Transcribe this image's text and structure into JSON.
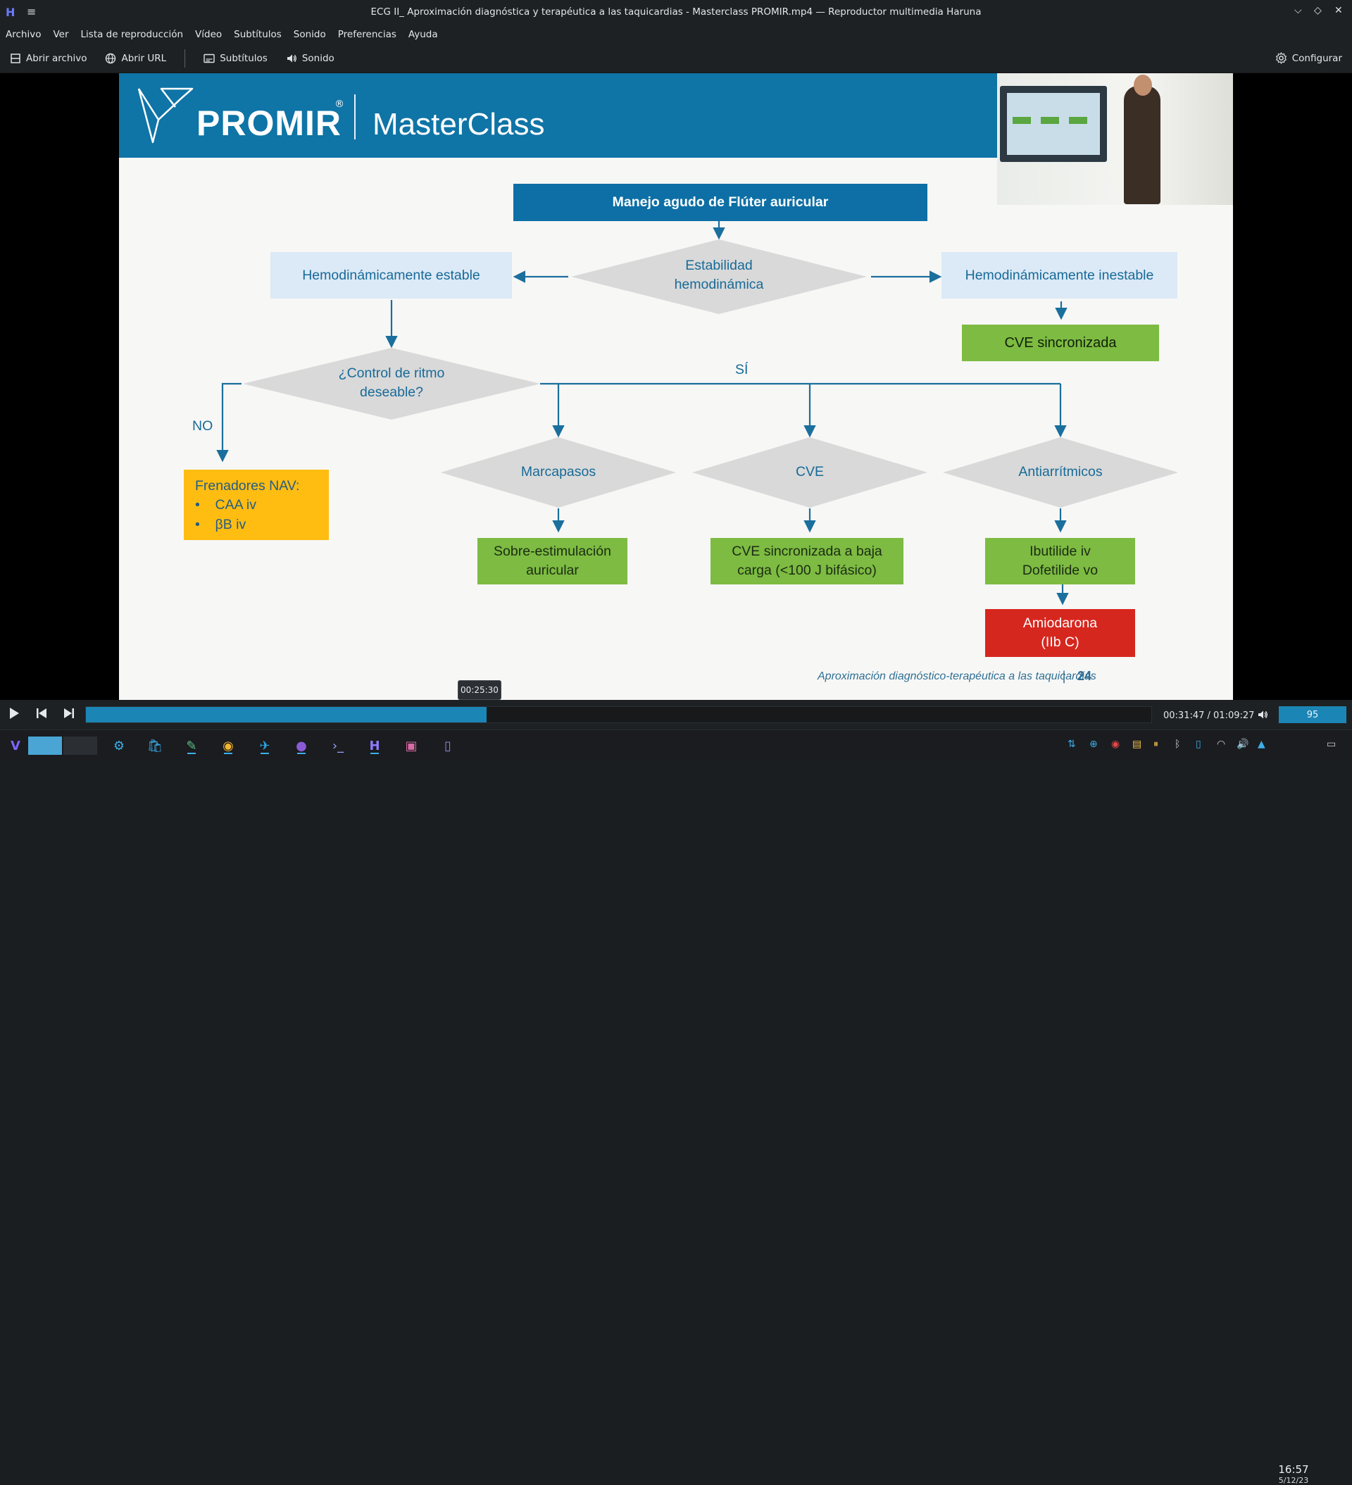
{
  "window": {
    "title": "ECG II_ Aproximación diagnóstica y terapéutica a las taquicardias - Masterclass PROMIR.mp4 — Reproductor multimedia Haruna",
    "app_icon": "haruna-logo",
    "menu_icon": "≡",
    "minimize_icon": "⌵",
    "maximize_icon": "◇",
    "close_icon": "✕"
  },
  "menubar": {
    "items": [
      "Archivo",
      "Ver",
      "Lista de reproducción",
      "Vídeo",
      "Subtítulos",
      "Sonido",
      "Preferencias",
      "Ayuda"
    ]
  },
  "toolbar": {
    "open_file": "Abrir archivo",
    "open_url": "Abrir URL",
    "subtitles": "Subtítulos",
    "sound": "Sonido",
    "settings": "Configurar"
  },
  "slide": {
    "brand": "PROMIR",
    "brand_mark": "®",
    "product": "MasterClass",
    "title_box": "Manejo agudo de Flúter auricular",
    "diamond_stability_1": "Estabilidad",
    "diamond_stability_2": "hemodinámica",
    "stable": "Hemodinámicamente estable",
    "unstable": "Hemodinámicamente inestable",
    "cve_sync": "CVE sincronizada",
    "diamond_rhythm_1": "¿Control de ritmo",
    "diamond_rhythm_2": "deseable?",
    "label_yes": "SÍ",
    "label_no": "NO",
    "frenadores_title": "Frenadores NAV:",
    "frenadores_items": [
      "CAA iv",
      "βB iv"
    ],
    "diamond_pacemaker": "Marcapasos",
    "diamond_cve": "CVE",
    "diamond_antiarr": "Antiarrítmicos",
    "overdrive_1": "Sobre-estimulación",
    "overdrive_2": "auricular",
    "cve_low_1": "CVE sincronizada a baja",
    "cve_low_2": "carga (<100 J bifásico)",
    "drugs_1": "Ibutilide iv",
    "drugs_2": "Dofetilide vo",
    "amio_1": "Amiodarona",
    "amio_2": "(IIb C)",
    "footer": "Aproximación diagnóstico-terapéutica a las taquicardias",
    "footer_sep": "|",
    "page_number": "24"
  },
  "player": {
    "hover_time": "00:25:30",
    "time_display": "00:31:47 / 01:09:27",
    "progress_fraction": 0.376,
    "volume": "95",
    "accent": "#1b86b5"
  },
  "taskbar": {
    "apps": [
      "kde-launcher",
      "system-settings",
      "discover",
      "kate",
      "chrome",
      "telegram",
      "tor-browser",
      "konsole",
      "haruna",
      "gwenview",
      "kdeconnect"
    ],
    "clock_time": "16:57",
    "clock_date": "5/12/23"
  }
}
